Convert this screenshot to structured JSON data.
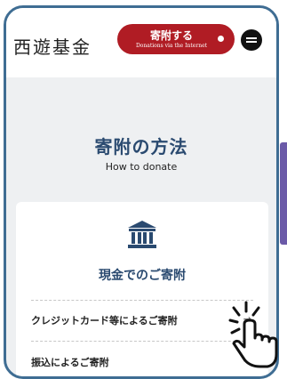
{
  "header": {
    "logo": "西遊基金",
    "donate_button": {
      "label": "寄附する",
      "sublabel": "Donations via the Internet"
    }
  },
  "section": {
    "title": "寄附の方法",
    "subtitle": "How to donate"
  },
  "card": {
    "title": "現金でのご寄附",
    "methods": [
      {
        "label": "クレジットカード等によるご寄附",
        "arrow": "→"
      },
      {
        "label": "振込によるご寄附",
        "arrow": "→"
      }
    ]
  },
  "colors": {
    "accent_red": "#b01c24",
    "title_navy": "#2a4a70",
    "frame_blue": "#3f6d93",
    "side_tab_purple": "#6b5aa8"
  },
  "icons": [
    "bank-icon",
    "menu-icon",
    "hand-pointer-icon"
  ]
}
